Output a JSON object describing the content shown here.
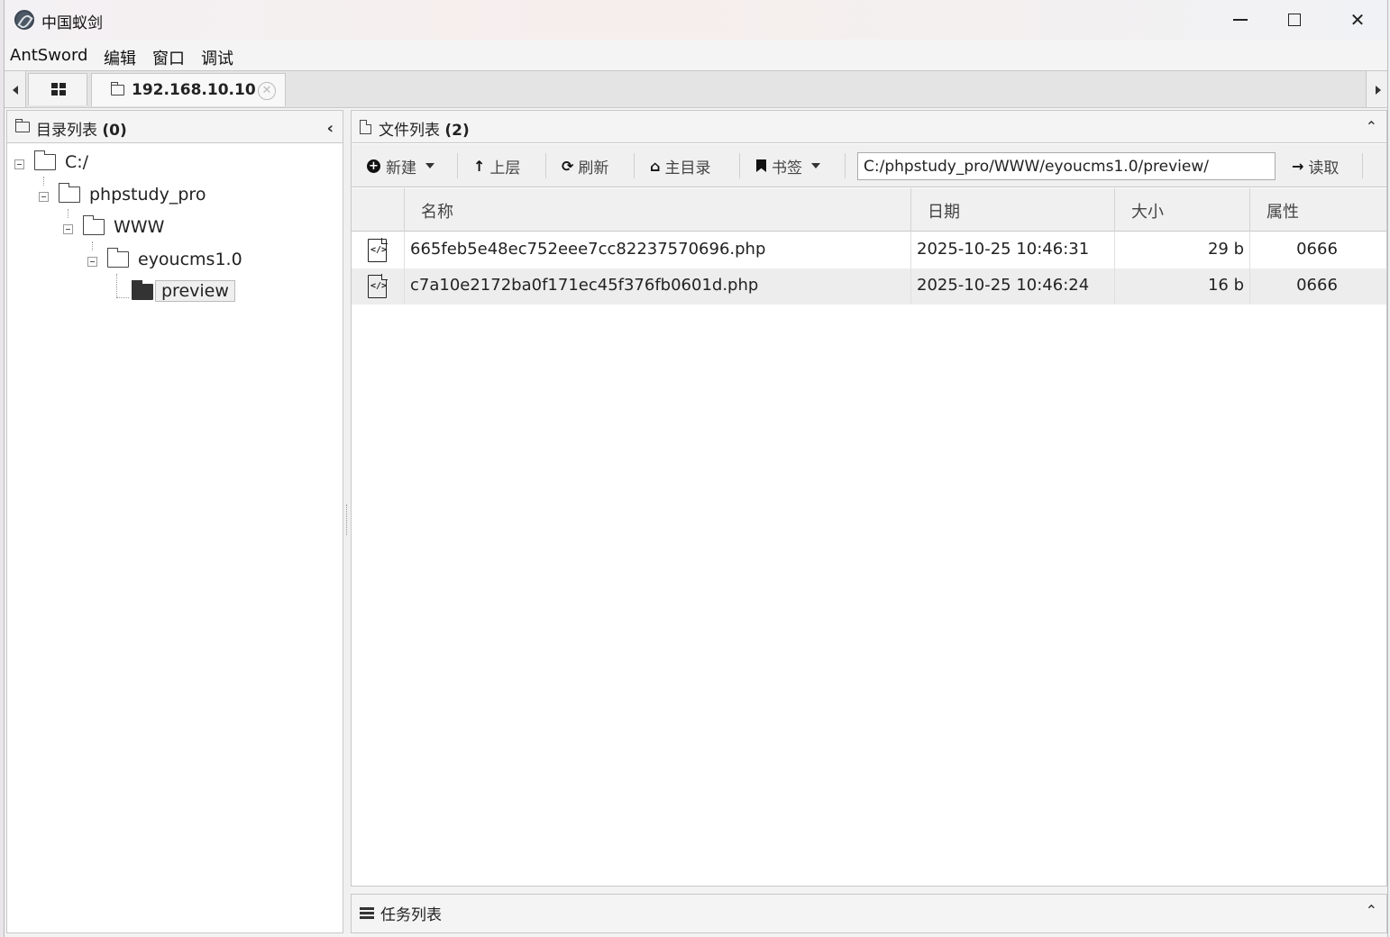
{
  "window": {
    "title": "中国蚁剑",
    "minimize_glyph": "",
    "close_glyph": "✕"
  },
  "menubar": [
    "AntSword",
    "编辑",
    "窗口",
    "调试"
  ],
  "tabs": {
    "active_label": "192.168.10.10",
    "close_glyph": "✕"
  },
  "left_pane": {
    "title": "目录列表",
    "count": "(0)",
    "collapse_glyph": "‹",
    "tree": [
      {
        "label": "C:/",
        "depth": 0,
        "selected": false
      },
      {
        "label": "phpstudy_pro",
        "depth": 1,
        "selected": false
      },
      {
        "label": "WWW",
        "depth": 2,
        "selected": false
      },
      {
        "label": "eyoucms1.0",
        "depth": 3,
        "selected": false
      },
      {
        "label": "preview",
        "depth": 4,
        "selected": true
      }
    ]
  },
  "right_pane": {
    "title": "文件列表",
    "count": "(2)",
    "collapse_glyph": "⌃",
    "toolbar": {
      "new_label": "新建",
      "up_label": "上层",
      "refresh_label": "刷新",
      "home_label": "主目录",
      "bookmark_label": "书签",
      "path_value": "C:/phpstudy_pro/WWW/eyoucms1.0/preview/",
      "read_label": "读取"
    },
    "columns": [
      "名称",
      "日期",
      "大小",
      "属性"
    ],
    "files": [
      {
        "name": "665feb5e48ec752eee7cc82237570696.php",
        "date": "2025-10-25 10:46:31",
        "size": "29 b",
        "perm": "0666"
      },
      {
        "name": "c7a10e2172ba0f171ec45f376fb0601d.php",
        "date": "2025-10-25 10:46:24",
        "size": "16 b",
        "perm": "0666"
      }
    ]
  },
  "task_pane": {
    "title": "任务列表",
    "collapse_glyph": "⌃"
  }
}
